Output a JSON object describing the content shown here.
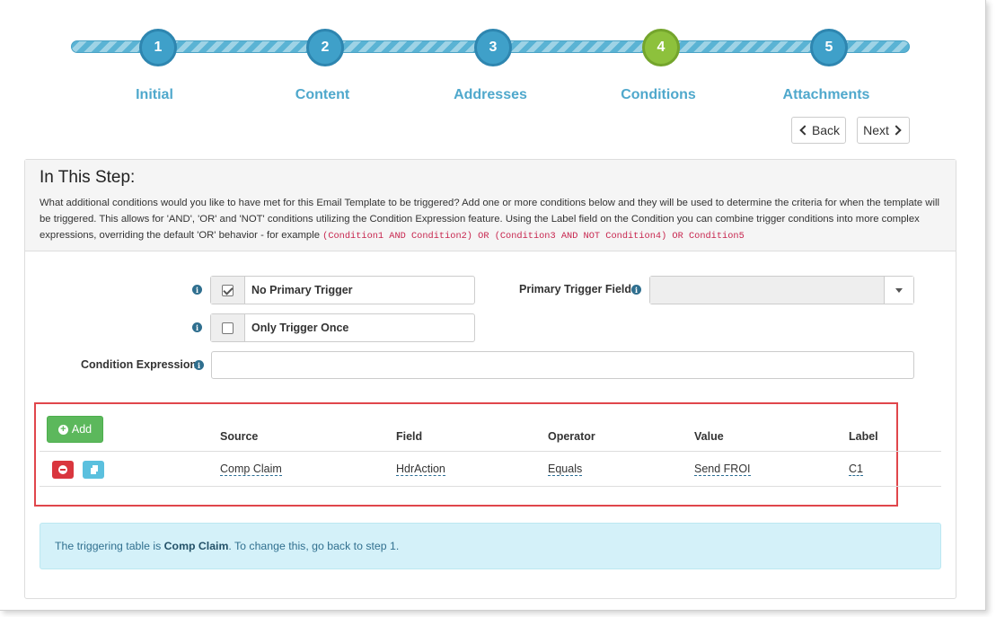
{
  "wizard": {
    "steps": [
      {
        "number": "1",
        "label": "Initial"
      },
      {
        "number": "2",
        "label": "Content"
      },
      {
        "number": "3",
        "label": "Addresses"
      },
      {
        "number": "4",
        "label": "Conditions"
      },
      {
        "number": "5",
        "label": "Attachments"
      }
    ],
    "active_step": 4,
    "back_label": "Back",
    "next_label": "Next"
  },
  "panel": {
    "title": "In This Step:",
    "description": "What additional conditions would you like to have met for this Email Template to be triggered? Add one or more conditions below and they will be used to determine the criteria for when the template will be triggered. This allows for 'AND', 'OR' and 'NOT' conditions utilizing the Condition Expression feature. Using the Label field on the Condition you can combine trigger conditions into more complex expressions, overriding the default 'OR' behavior - for example",
    "example_code": "(Condition1 AND Condition2) OR (Condition3 AND NOT Condition4) OR Condition5"
  },
  "form": {
    "no_primary_trigger": {
      "label": "No Primary Trigger",
      "checked": true
    },
    "only_trigger_once": {
      "label": "Only Trigger Once",
      "checked": false
    },
    "primary_trigger_field": {
      "label": "Primary Trigger Field",
      "value": ""
    },
    "condition_expression": {
      "label": "Condition Expression",
      "value": ""
    }
  },
  "conditions_table": {
    "add_label": "Add",
    "columns": [
      "Source",
      "Field",
      "Operator",
      "Value",
      "Label"
    ],
    "rows": [
      {
        "source": "Comp Claim",
        "field": "HdrAction",
        "operator": "Equals",
        "value": "Send FROI",
        "label": "C1"
      }
    ]
  },
  "alert": {
    "prefix": "The triggering table is ",
    "table_name": "Comp Claim",
    "suffix": ". To change this, go back to step 1."
  },
  "colors": {
    "step_default": "#3fa0c9",
    "step_active": "#8dc13c",
    "step_label": "#4fa8cc",
    "add_button": "#5cb85c",
    "delete_button": "#d9363e",
    "copy_button": "#5bc0de",
    "highlight_border": "#e0464b",
    "alert_bg": "#d4f1f9"
  }
}
